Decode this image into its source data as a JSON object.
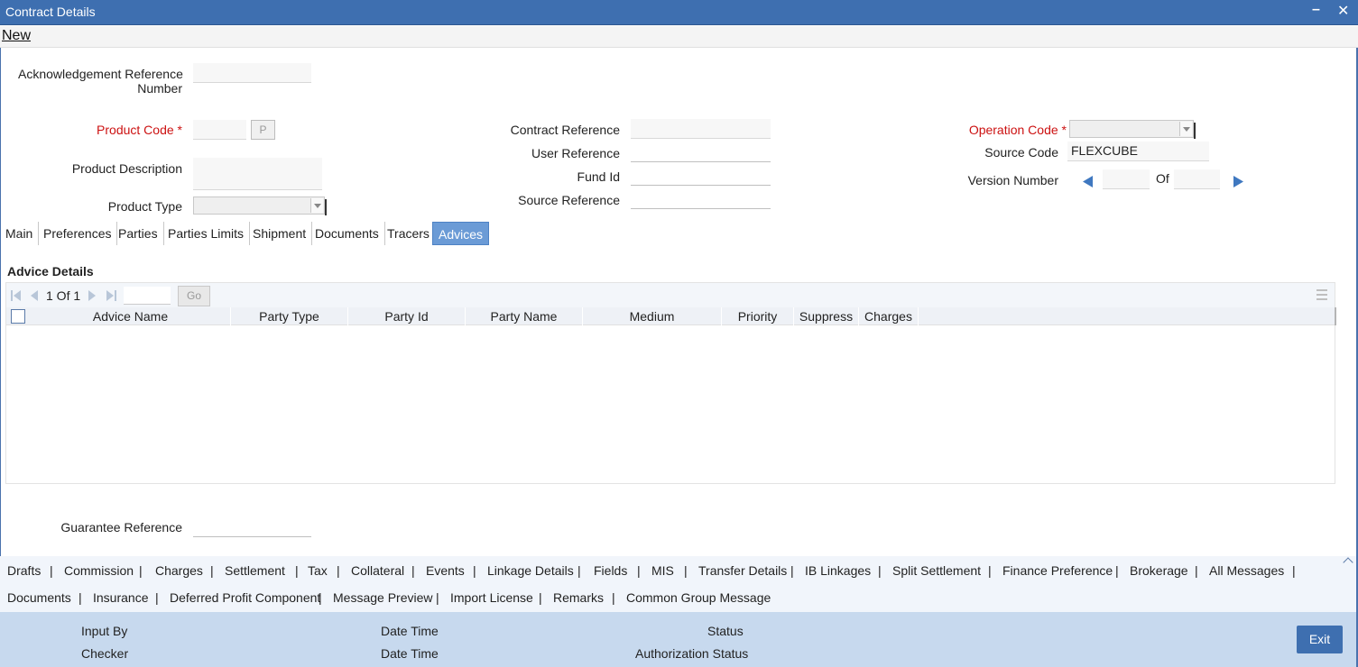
{
  "window": {
    "title": "Contract Details",
    "minimize_icon": "minimize-icon",
    "close_icon": "close-icon"
  },
  "menu": {
    "new": "New"
  },
  "form": {
    "ack_ref_label": "Acknowledgement Reference",
    "ack_ref_label2": "Number",
    "ack_ref_value": "",
    "product_code_label": "Product Code",
    "product_code_value": "",
    "product_code_btn": "P",
    "product_desc_label": "Product Description",
    "product_desc_value": "",
    "product_type_label": "Product Type",
    "product_type_value": "",
    "contract_ref_label": "Contract Reference",
    "contract_ref_value": "",
    "user_ref_label": "User Reference",
    "user_ref_value": "",
    "fund_id_label": "Fund Id",
    "fund_id_value": "",
    "source_ref_label": "Source Reference",
    "source_ref_value": "",
    "operation_code_label": "Operation Code",
    "operation_code_value": "",
    "source_code_label": "Source Code",
    "source_code_value": "FLEXCUBE",
    "version_label": "Version Number",
    "version_of": "Of",
    "version_value": "",
    "version_total": "",
    "required_mark": "*"
  },
  "tabs": [
    {
      "label": "Main"
    },
    {
      "label": "Preferences"
    },
    {
      "label": "Parties"
    },
    {
      "label": "Parties Limits"
    },
    {
      "label": "Shipment"
    },
    {
      "label": "Documents"
    },
    {
      "label": "Tracers"
    },
    {
      "label": "Advices",
      "active": true
    }
  ],
  "advice": {
    "section_title": "Advice Details",
    "pager_text": "1 Of 1",
    "go_label": "Go",
    "columns": [
      "Advice Name",
      "Party Type",
      "Party Id",
      "Party Name",
      "Medium",
      "Priority",
      "Suppress",
      "Charges"
    ]
  },
  "guarantee": {
    "label": "Guarantee Reference",
    "value": ""
  },
  "links_row1": [
    "Drafts",
    "Commission",
    "Charges",
    "Settlement",
    "Tax",
    "Collateral",
    "Events",
    "Linkage Details",
    "Fields",
    "MIS",
    "Transfer Details",
    "IB Linkages",
    "Split Settlement",
    "Finance Preference",
    "Brokerage",
    "All Messages"
  ],
  "links_row2": [
    "Documents",
    "Insurance",
    "Deferred Profit Component",
    "Message Preview",
    "Import License",
    "Remarks",
    "Common Group Message"
  ],
  "separator": "|",
  "footer": {
    "input_by": "Input By",
    "checker": "Checker",
    "date_time_1": "Date Time",
    "date_time_2": "Date Time",
    "status": "Status",
    "auth_status": "Authorization Status",
    "exit": "Exit"
  },
  "colors": {
    "title_bar": "#3e6fb0",
    "active_tab": "#6b9bd6",
    "footer": "#c7d9ee",
    "required": "#cc1111"
  }
}
